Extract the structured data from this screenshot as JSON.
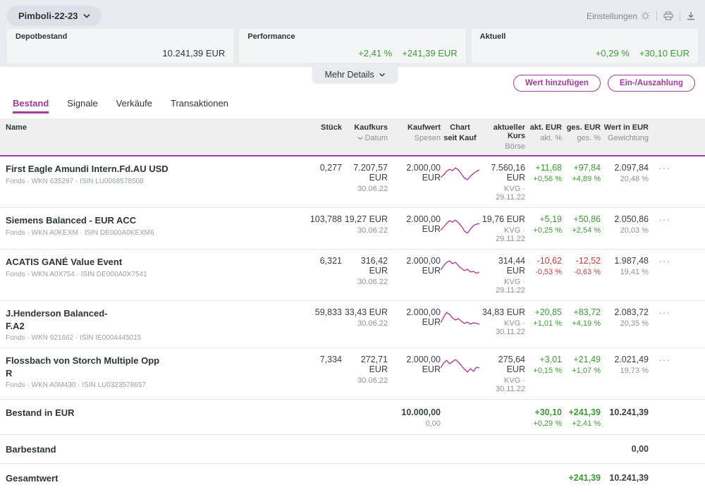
{
  "colors": {
    "accent": "#a6399c",
    "positive": "#3e9c35",
    "negative": "#cf3b3b",
    "spark": "#b23a98"
  },
  "header": {
    "portfolio_name": "Pimboli-22-23",
    "settings_label": "Einstellungen",
    "more_details_label": "Mehr Details",
    "icons": {
      "portfolio_selector": "chevron-down",
      "settings": "gear",
      "print": "printer",
      "export": "download"
    },
    "cards": [
      {
        "label": "Depotbestand",
        "value": "10.241,39 EUR"
      },
      {
        "label": "Performance",
        "pct": "+2,41 %",
        "value": "+241,39 EUR"
      },
      {
        "label": "Aktuell",
        "pct": "+0,29 %",
        "value": "+30,10 EUR"
      }
    ]
  },
  "actions": {
    "add_value": "Wert hinzufügen",
    "cash": "Ein-/Auszahlung"
  },
  "tabs": [
    {
      "label": "Bestand",
      "active": true
    },
    {
      "label": "Signale",
      "active": false
    },
    {
      "label": "Verkäufe",
      "active": false
    },
    {
      "label": "Transaktionen",
      "active": false
    }
  ],
  "table": {
    "columns": {
      "name": {
        "top": "Name",
        "bottom": ""
      },
      "stueck": {
        "top": "Stück",
        "bottom": ""
      },
      "kaufkurs": {
        "top": "Kaufkurs",
        "bottom": "Datum",
        "sort_icon": "chevron-down"
      },
      "kaufwert": {
        "top": "Kaufwert",
        "bottom": "Spesen"
      },
      "chart": {
        "top": "Chart",
        "bottom": "seit Kauf"
      },
      "akt_kurs": {
        "top": "aktueller Kurs",
        "bottom": "Börse"
      },
      "akt_eur": {
        "top": "akt. EUR",
        "bottom": "akt. %"
      },
      "ges_eur": {
        "top": "ges. EUR",
        "bottom": "ges. %"
      },
      "wert": {
        "top": "Wert in EUR",
        "bottom": "Gewichtung"
      }
    },
    "rows": [
      {
        "name": "First Eagle Amundi Intern.Fd.AU USD",
        "meta": "Fonds · WKN 635297 · ISIN LU0068578508",
        "stueck": "0,277",
        "kaufkurs": "7.207,57 EUR",
        "datum": "30.06.22",
        "kaufwert": "2.000,00 EUR",
        "spesen": "",
        "akt_kurs": "7.560,16 EUR",
        "boerse": "KVG · 29.11.22",
        "akt_eur": "+11,68",
        "akt_pct": "+0,56 %",
        "ges_eur": "+97,84",
        "ges_pct": "+4,89 %",
        "wert": "2.097,84",
        "gewichtung": "20,48 %",
        "menu": "···",
        "sparkline": [
          19,
          15,
          10,
          7,
          9,
          5,
          8,
          14,
          20,
          22,
          17,
          13,
          10,
          8
        ]
      },
      {
        "name": "Siemens Balanced - EUR ACC",
        "meta": "Fonds · WKN A0KEXM · ISIN DE000A0KEXM6",
        "stueck": "103,788",
        "kaufkurs": "19,27 EUR",
        "datum": "30.06.22",
        "kaufwert": "2.000,00 EUR",
        "spesen": "",
        "akt_kurs": "19,76 EUR",
        "boerse": "KVG · 29.11.22",
        "akt_eur": "+5,19",
        "akt_pct": "+0,25 %",
        "ges_eur": "+50,86",
        "ges_pct": "+2,54 %",
        "wert": "2.050,86",
        "gewichtung": "20,03 %",
        "menu": "···",
        "sparkline": [
          21,
          16,
          11,
          7,
          9,
          6,
          10,
          15,
          22,
          25,
          19,
          14,
          12,
          11
        ]
      },
      {
        "name": "ACATIS GANÉ Value Event",
        "meta": "Fonds · WKN A0X754 · ISIN DE000A0X7541",
        "stueck": "6,321",
        "kaufkurs": "316,42 EUR",
        "datum": "30.06.22",
        "kaufwert": "2.000,00 EUR",
        "spesen": "",
        "akt_kurs": "314,44 EUR",
        "boerse": "KVG · 29.11.22",
        "akt_eur": "-10,62",
        "akt_pct": "-0,53 %",
        "ges_eur": "-12,52",
        "ges_pct": "-0,63 %",
        "wert": "1.987,48",
        "gewichtung": "19,41 %",
        "menu": "···",
        "sparkline": [
          18,
          12,
          7,
          5,
          9,
          7,
          12,
          16,
          19,
          17,
          21,
          20,
          23,
          21
        ]
      },
      {
        "name": "J.Henderson Balanced-\nF.A2",
        "meta": "Fonds · WKN 921662 · ISIN IE0004445015",
        "stueck": "59,833",
        "kaufkurs": "33,43 EUR",
        "datum": "30.06.22",
        "kaufwert": "2.000,00 EUR",
        "spesen": "",
        "akt_kurs": "34,83 EUR",
        "boerse": "KVG · 30.11.22",
        "akt_eur": "+20,85",
        "akt_pct": "+1,01 %",
        "ges_eur": "+83,72",
        "ges_pct": "+4,19 %",
        "wert": "2.083,72",
        "gewichtung": "20,35 %",
        "menu": "···",
        "sparkline": [
          20,
          12,
          5,
          8,
          13,
          16,
          14,
          18,
          21,
          19,
          22,
          20,
          21,
          22
        ]
      },
      {
        "name": "Flossbach von Storch Multiple Opp\nR",
        "meta": "Fonds · WKN A0M430 · ISIN LU0323578657",
        "stueck": "7,334",
        "kaufkurs": "272,71 EUR",
        "datum": "30.06.22",
        "kaufwert": "2.000,00 EUR",
        "spesen": "",
        "akt_kurs": "275,64 EUR",
        "boerse": "KVG · 30.11.22",
        "akt_eur": "+3,01",
        "akt_pct": "+0,15 %",
        "ges_eur": "+21,49",
        "ges_pct": "+1,07 %",
        "wert": "2.021,49",
        "gewichtung": "19,73 %",
        "menu": "···",
        "sparkline": [
          17,
          10,
          6,
          11,
          8,
          5,
          9,
          14,
          19,
          23,
          18,
          22,
          16,
          17
        ]
      }
    ],
    "summary": {
      "bestand": {
        "label": "Bestand in EUR",
        "kaufwert": "10.000,00",
        "spesen": "0,00",
        "akt_eur": "+30,10",
        "akt_pct": "+0,29 %",
        "ges_eur": "+241,39",
        "ges_pct": "+2,41 %",
        "wert": "10.241,39"
      },
      "barbestand": {
        "label": "Barbestand",
        "wert": "0,00"
      },
      "gesamtwert": {
        "label": "Gesamtwert",
        "ges_eur": "+241,39",
        "wert": "10.241,39"
      }
    }
  }
}
